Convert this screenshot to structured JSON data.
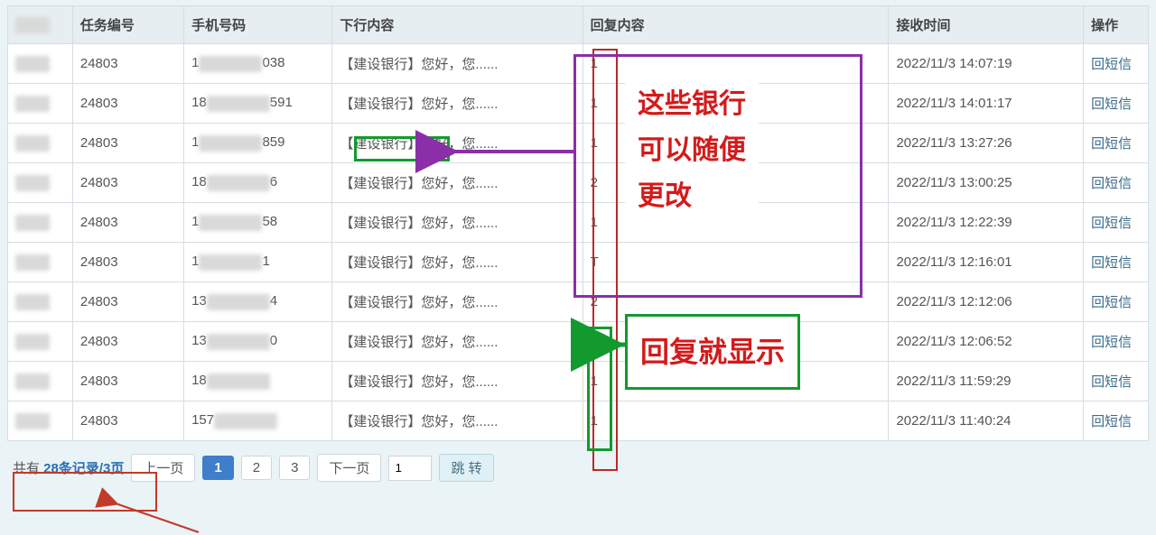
{
  "columns": [
    "",
    "任务编号",
    "手机号码",
    "下行内容",
    "回复内容",
    "接收时间",
    "操作"
  ],
  "rows": [
    {
      "task": "24803",
      "phone_pre": "1",
      "phone_suf": "038",
      "content": "【建设银行】您好，您......",
      "reply": "1",
      "time": "2022/11/3 14:07:19",
      "op": "回短信"
    },
    {
      "task": "24803",
      "phone_pre": "18",
      "phone_suf": "591",
      "content": "【建设银行】您好，您......",
      "reply": "1",
      "time": "2022/11/3 14:01:17",
      "op": "回短信"
    },
    {
      "task": "24803",
      "phone_pre": "1",
      "phone_suf": "859",
      "content": "【建设银行】您好，您......",
      "reply": "1",
      "time": "2022/11/3 13:27:26",
      "op": "回短信"
    },
    {
      "task": "24803",
      "phone_pre": "18",
      "phone_suf": "6",
      "content": "【建设银行】您好，您......",
      "reply": "2",
      "time": "2022/11/3 13:00:25",
      "op": "回短信"
    },
    {
      "task": "24803",
      "phone_pre": "1",
      "phone_suf": "58",
      "content": "【建设银行】您好，您......",
      "reply": "1",
      "time": "2022/11/3 12:22:39",
      "op": "回短信"
    },
    {
      "task": "24803",
      "phone_pre": "1",
      "phone_suf": "1",
      "content": "【建设银行】您好，您......",
      "reply": "T",
      "time": "2022/11/3 12:16:01",
      "op": "回短信"
    },
    {
      "task": "24803",
      "phone_pre": "13",
      "phone_suf": "4",
      "content": "【建设银行】您好，您......",
      "reply": "2",
      "time": "2022/11/3 12:12:06",
      "op": "回短信"
    },
    {
      "task": "24803",
      "phone_pre": "13",
      "phone_suf": "0",
      "content": "【建设银行】您好，您......",
      "reply": "1",
      "time": "2022/11/3 12:06:52",
      "op": "回短信"
    },
    {
      "task": "24803",
      "phone_pre": "18",
      "phone_suf": "",
      "content": "【建设银行】您好，您......",
      "reply": "1",
      "time": "2022/11/3 11:59:29",
      "op": "回短信"
    },
    {
      "task": "24803",
      "phone_pre": "157",
      "phone_suf": "",
      "content": "【建设银行】您好，您......",
      "reply": "1",
      "time": "2022/11/3 11:40:24",
      "op": "回短信"
    }
  ],
  "pagination": {
    "total_label_prefix": "共有 ",
    "total_label": "28条记录/3页",
    "prev": "上一页",
    "pages": [
      "1",
      "2",
      "3"
    ],
    "next": "下一页",
    "input": "1",
    "jump": "跳 转"
  },
  "annotations": {
    "text1_line1": "这些银行",
    "text1_line2": "可以随便",
    "text1_line3": "更改",
    "text2": "回复就显示"
  }
}
